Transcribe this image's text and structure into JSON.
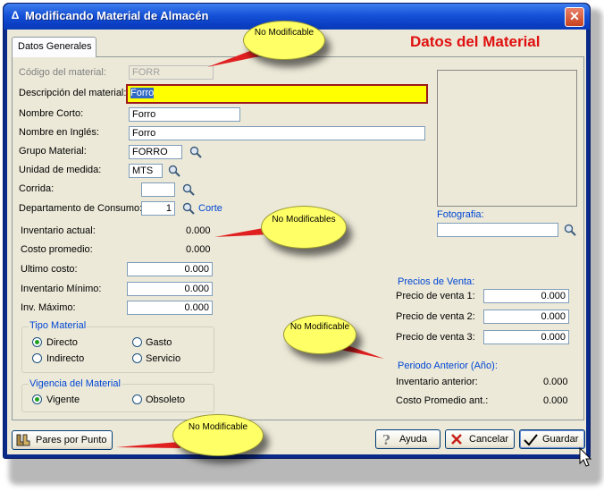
{
  "window": {
    "title": "Modificando Material  de Almacén",
    "close_glyph": "✕",
    "app_glyph": "Δ"
  },
  "tab": {
    "label": "Datos Generales"
  },
  "heading": "Datos del Material",
  "fields": {
    "codigo": {
      "label": "Código del material:",
      "value": "FORR"
    },
    "descripcion": {
      "label": "Descripción del material:",
      "value": "Forro"
    },
    "nombre_corto": {
      "label": "Nombre Corto:",
      "value": "Forro"
    },
    "nombre_ingles": {
      "label": "Nombre en Inglés:",
      "value": "Forro"
    },
    "grupo": {
      "label": "Grupo Material:",
      "value": "FORRO"
    },
    "unidad": {
      "label": "Unidad de medida:",
      "value": "MTS"
    },
    "corrida": {
      "label": "Corrida:",
      "value": ""
    },
    "departamento": {
      "label": "Departamento de Consumo:",
      "value": "1",
      "link": "Corte"
    },
    "inventario_actual": {
      "label": "Inventario actual:",
      "value": "0.000"
    },
    "costo_promedio": {
      "label": "Costo promedio:",
      "value": "0.000"
    },
    "ultimo_costo": {
      "label": "Ultimo costo:",
      "value": "0.000"
    },
    "inv_minimo": {
      "label": "Inventario Mínimo:",
      "value": "0.000"
    },
    "inv_maximo": {
      "label": "Inv. Máximo:",
      "value": "0.000"
    }
  },
  "tipo_material": {
    "title": "Tipo Material",
    "options": [
      {
        "label": "Directo",
        "selected": true
      },
      {
        "label": "Gasto",
        "selected": false
      },
      {
        "label": "Indirecto",
        "selected": false
      },
      {
        "label": "Servicio",
        "selected": false
      }
    ]
  },
  "vigencia": {
    "title": "Vigencia del Material",
    "options": [
      {
        "label": "Vigente",
        "selected": true
      },
      {
        "label": "Obsoleto",
        "selected": false
      }
    ]
  },
  "fotografia": {
    "label": "Fotografia:",
    "value": ""
  },
  "precios": {
    "title": "Precios de Venta:",
    "rows": [
      {
        "label": "Precio de venta 1:",
        "value": "0.000"
      },
      {
        "label": "Precio de venta 2:",
        "value": "0.000"
      },
      {
        "label": "Precio de venta 3:",
        "value": "0.000"
      }
    ]
  },
  "periodo_anterior": {
    "title": "Periodo Anterior (Año):",
    "rows": [
      {
        "label": "Inventario anterior:",
        "value": "0.000"
      },
      {
        "label": "Costo Promedio ant.:",
        "value": "0.000"
      }
    ]
  },
  "buttons": {
    "pares": "Pares por Punto",
    "ayuda": "Ayuda",
    "cancelar": "Cancelar",
    "guardar": "Guardar"
  },
  "callouts": {
    "c1": "No Modificable",
    "c2": "No Modificables",
    "c3": "No Modificable",
    "c4": "No Modificable"
  },
  "colors": {
    "title_bar": "#1552d8",
    "heading": "#e01010",
    "highlight_field": "#ffff00",
    "group_title": "#0046d5",
    "callout": "#ffff66",
    "callout_arrow": "#e02020"
  }
}
